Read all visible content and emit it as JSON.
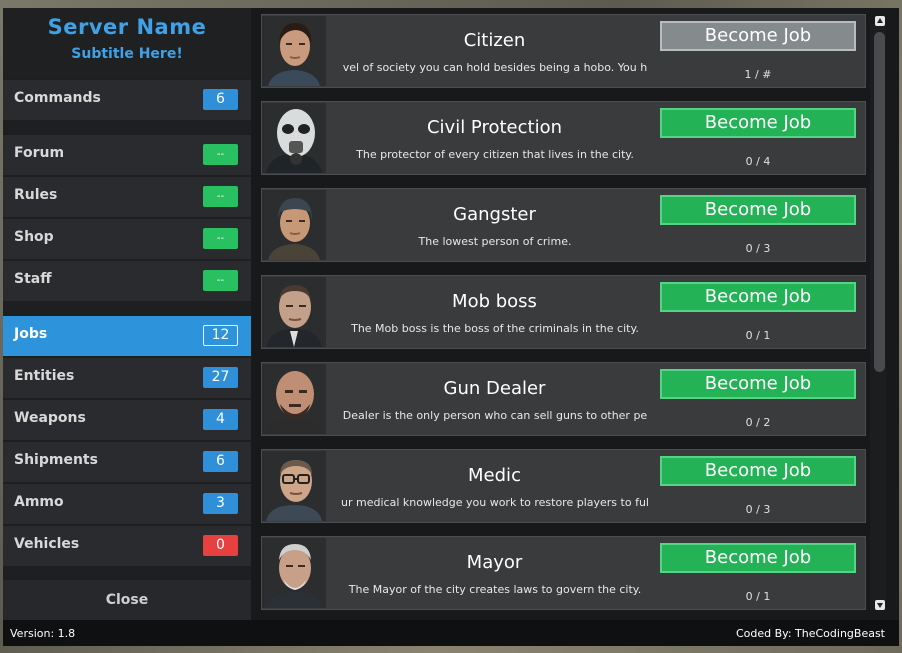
{
  "brand": {
    "title": "Server Name",
    "subtitle": "Subtitle Here!"
  },
  "sidebar": {
    "items": [
      {
        "key": "commands",
        "label": "Commands",
        "badge": "6",
        "badge_color": "blue"
      },
      {
        "key": "forum",
        "label": "Forum",
        "badge": "--",
        "badge_color": "green"
      },
      {
        "key": "rules",
        "label": "Rules",
        "badge": "--",
        "badge_color": "green"
      },
      {
        "key": "shop",
        "label": "Shop",
        "badge": "--",
        "badge_color": "green"
      },
      {
        "key": "staff",
        "label": "Staff",
        "badge": "--",
        "badge_color": "green"
      },
      {
        "key": "jobs",
        "label": "Jobs",
        "badge": "12",
        "badge_color": "active"
      },
      {
        "key": "entities",
        "label": "Entities",
        "badge": "27",
        "badge_color": "blue"
      },
      {
        "key": "weapons",
        "label": "Weapons",
        "badge": "4",
        "badge_color": "blue"
      },
      {
        "key": "shipments",
        "label": "Shipments",
        "badge": "6",
        "badge_color": "blue"
      },
      {
        "key": "ammo",
        "label": "Ammo",
        "badge": "3",
        "badge_color": "blue"
      },
      {
        "key": "vehicles",
        "label": "Vehicles",
        "badge": "0",
        "badge_color": "red"
      }
    ],
    "active": "jobs",
    "close_label": "Close"
  },
  "jobs": [
    {
      "name": "Citizen",
      "description": "vel of society you can hold besides being a hobo. You h",
      "button": "Become Job",
      "slots": "1 / #",
      "enabled": false,
      "avatar": "citizen-icon"
    },
    {
      "name": "Civil Protection",
      "description": "The protector of every citizen that lives in the city.",
      "button": "Become Job",
      "slots": "0 / 4",
      "enabled": true,
      "avatar": "civil-protection-icon"
    },
    {
      "name": "Gangster",
      "description": "The lowest person of crime.",
      "button": "Become Job",
      "slots": "0 / 3",
      "enabled": true,
      "avatar": "gangster-icon"
    },
    {
      "name": "Mob boss",
      "description": "The Mob boss is the boss of the criminals in the city.",
      "button": "Become Job",
      "slots": "0 / 1",
      "enabled": true,
      "avatar": "mob-boss-icon"
    },
    {
      "name": "Gun Dealer",
      "description": "Dealer is the only person who can sell guns to other pe",
      "button": "Become Job",
      "slots": "0 / 2",
      "enabled": true,
      "avatar": "gun-dealer-icon"
    },
    {
      "name": "Medic",
      "description": "ur medical knowledge you work to restore players to ful",
      "button": "Become Job",
      "slots": "0 / 3",
      "enabled": true,
      "avatar": "medic-icon"
    },
    {
      "name": "Mayor",
      "description": "The Mayor of the city creates laws to govern the city.",
      "button": "Become Job",
      "slots": "0 / 1",
      "enabled": true,
      "avatar": "mayor-icon"
    }
  ],
  "footer": {
    "version": "Version: 1.8",
    "coded_by": "Coded By: TheCodingBeast"
  },
  "colors": {
    "accent": "#2d93da",
    "green": "#24b257",
    "red": "#e64040",
    "disabled": "#858a8c"
  }
}
